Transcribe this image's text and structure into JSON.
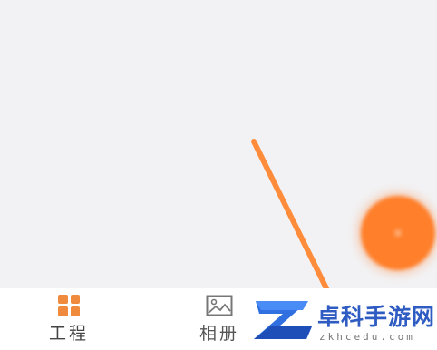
{
  "canvas": {
    "stroke_color": "#ff8c3a"
  },
  "fab": {
    "color": "#ff7f2a"
  },
  "tabbar": {
    "tabs": [
      {
        "label": "工程",
        "icon": "grid-icon",
        "active": true
      },
      {
        "label": "相册",
        "icon": "image-icon",
        "active": false
      }
    ]
  },
  "watermark": {
    "title": "卓科手游网",
    "subtitle": "zkhcedu.com"
  },
  "colors": {
    "accent": "#f08a3c",
    "watermark_blue": "#2f5cc2"
  }
}
